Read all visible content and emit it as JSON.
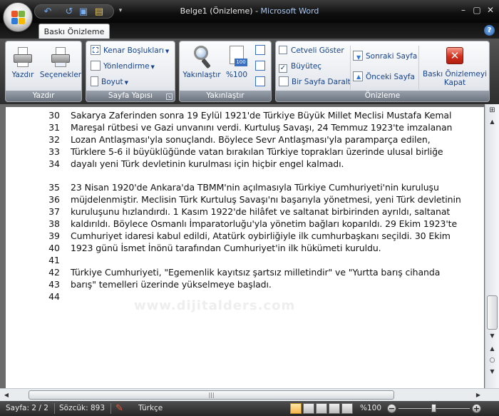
{
  "window": {
    "doc_title": "Belge1 (Önizleme)",
    "separator": " - ",
    "app_name": "Microsoft Word",
    "minimize": "–",
    "maximize": "▢",
    "close": "✕"
  },
  "qat": {
    "undo": "↶",
    "redo": "↺",
    "save": "▣",
    "open": "▤",
    "more": "▾"
  },
  "tabs": {
    "active": "Baskı Önizleme",
    "help": "?"
  },
  "ribbon": {
    "print_group": {
      "label": "Yazdır",
      "print": "Yazdır",
      "options": "Seçenekler"
    },
    "page_setup_group": {
      "label": "Sayfa Yapısı",
      "margins": "Kenar Boşlukları",
      "orientation": "Yönlendirme",
      "size": "Boyut"
    },
    "zoom_group": {
      "label": "Yakınlaştır",
      "zoom": "Yakınlaştır",
      "zoom100": "%100",
      "badge100": "100"
    },
    "preview_group": {
      "label": "Önizleme",
      "ruler": "Cetveli Göster",
      "ruler_checked": false,
      "magnifier": "Büyüteç",
      "magnifier_checked": true,
      "shrink": "Bir Sayfa Daralt",
      "next_page": "Sonraki Sayfa",
      "prev_page": "Önceki Sayfa",
      "close_line1": "Baskı Önizlemeyi",
      "close_line2": "Kapat"
    }
  },
  "document": {
    "lines": [
      {
        "n": "30",
        "t": "Sakarya Zaferinden sonra 19 Eylül 1921'de Türkiye Büyük Millet Meclisi Mustafa Kemal"
      },
      {
        "n": "31",
        "t": "Mareşal rütbesi ve Gazi unvanını verdi. Kurtuluş Savaşı, 24 Temmuz 1923'te imzalanan"
      },
      {
        "n": "32",
        "t": "Lozan Antlaşması'yla sonuçlandı. Böylece Sevr Antlaşması'yla paramparça edilen,"
      },
      {
        "n": "33",
        "t": "Türklere 5-6 il büyüklüğünde vatan bırakılan Türkiye toprakları üzerinde ulusal birliğe"
      },
      {
        "n": "34",
        "t": "dayalı yeni Türk devletinin kurulması için hiçbir engel kalmadı."
      },
      {
        "n": "35",
        "t": "23 Nisan 1920'de Ankara'da TBMM'nin açılmasıyla Türkiye Cumhuriyeti'nin kuruluşu"
      },
      {
        "n": "36",
        "t": "müjdelenmiştir. Meclisin Türk Kurtuluş Savaşı'nı başarıyla yönetmesi, yeni Türk devletinin"
      },
      {
        "n": "37",
        "t": "kuruluşunu hızlandırdı. 1 Kasım 1922'de hilâfet ve saltanat birbirinden ayrıldı, saltanat"
      },
      {
        "n": "38",
        "t": "kaldırıldı. Böylece Osmanlı İmparatorluğu'yla yönetim bağları koparıldı. 29 Ekim 1923'te"
      },
      {
        "n": "39",
        "t": "Cumhuriyet idaresi kabul edildi, Atatürk oybirliğiyle ilk cumhurbaşkanı seçildi. 30 Ekim"
      },
      {
        "n": "40",
        "t": "1923 günü İsmet İnönü tarafından Cumhuriyet'in ilk hükümeti kuruldu."
      },
      {
        "n": "41",
        "t": ""
      },
      {
        "n": "42",
        "t": "Türkiye Cumhuriyeti, \"Egemenlik kayıtsız şartsız milletindir\" ve \"Yurtta barış cihanda"
      },
      {
        "n": "43",
        "t": "barış\" temelleri üzerinde yükselmeye başladı."
      },
      {
        "n": "44",
        "t": ""
      }
    ],
    "watermark": "www.dijitalders.com"
  },
  "status": {
    "page": "Sayfa: 2 / 2",
    "words": "Sözcük: 893",
    "language": "Türkçe",
    "zoom": "%100",
    "zoom_minus": "−",
    "zoom_plus": "+"
  },
  "colors": {
    "accent": "#15428b",
    "title_app": "#a9c7f5"
  }
}
